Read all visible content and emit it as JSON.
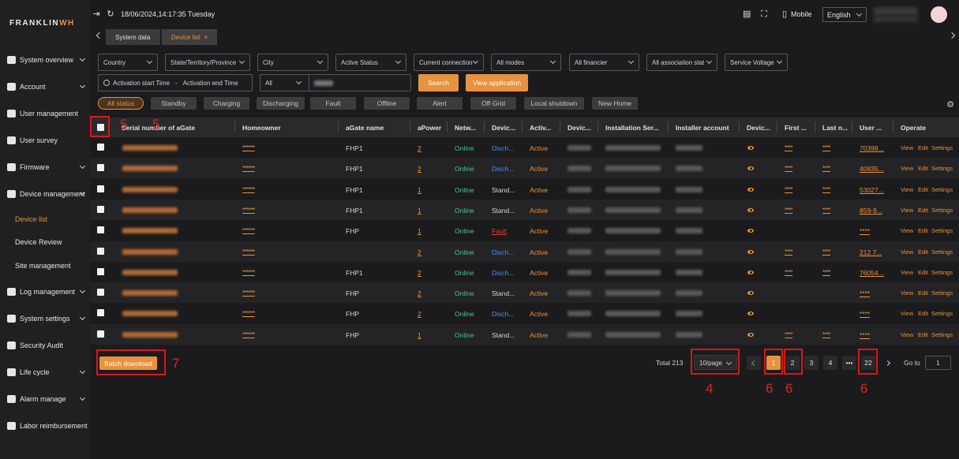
{
  "brand": {
    "logo_pre": "FRANKLIN",
    "logo_post": "WH"
  },
  "header": {
    "datetime": "18/06/2024,14:17:35 Tuesday",
    "mobile_label": "Mobile",
    "language": "English"
  },
  "sidebar": {
    "items": [
      {
        "label": "System overview",
        "has_chevron": true
      },
      {
        "label": "Account",
        "has_chevron": true
      },
      {
        "label": "User management",
        "has_chevron": false
      },
      {
        "label": "User survey",
        "has_chevron": false
      },
      {
        "label": "Firmware",
        "has_chevron": true
      },
      {
        "label": "Device management",
        "has_chevron": true
      },
      {
        "label": "Log management",
        "has_chevron": true
      },
      {
        "label": "System settings",
        "has_chevron": true
      },
      {
        "label": "Security Audit",
        "has_chevron": false
      },
      {
        "label": "Life cycle",
        "has_chevron": true
      },
      {
        "label": "Alarm manage",
        "has_chevron": true
      },
      {
        "label": "Labor reimbursement",
        "has_chevron": false
      }
    ],
    "sub_items": [
      "Device list",
      "Device Review",
      "Site management"
    ],
    "active_sub": "Device list"
  },
  "tabs": {
    "system_data": "System data",
    "device_list": "Device list",
    "close": "×"
  },
  "filters": {
    "row1": [
      "Country",
      "State/Territory/Province",
      "City",
      "Active Status",
      "Current connection",
      "All modes",
      "All financier",
      "All association stat",
      "Service Voltage"
    ],
    "activation_start": "Activation start Time",
    "date_sep": "-",
    "activation_end": "Activation end Time",
    "scope": "All",
    "search_button": "Search",
    "view_application_button": "View application"
  },
  "status_chips": [
    "All status",
    "Standby",
    "Charging",
    "Discharging",
    "Fault",
    "Offline",
    "Alert",
    "Off-Grid",
    "Local shutdown",
    "New Home"
  ],
  "table": {
    "headers": [
      "Serial number of aGate",
      "Homeowner",
      "aGate name",
      "aPower",
      "Netw...",
      "Devic...",
      "Activ...",
      "Devic...",
      "Installation Ser...",
      "Installer account",
      "Devic...",
      "First ...",
      "Last n...",
      "User ...",
      "Operate"
    ],
    "rows": [
      {
        "homeowner": "******",
        "agate_name": "FHP1",
        "apower": "2",
        "network": "Online",
        "device_status": "Disch...",
        "active": "Active",
        "first": "****",
        "last": "****",
        "user": "70398..."
      },
      {
        "homeowner": "******",
        "agate_name": "FHP1",
        "apower": "2",
        "network": "Online",
        "device_status": "Disch...",
        "active": "Active",
        "first": "****",
        "last": "****",
        "user": "40835..."
      },
      {
        "homeowner": "******",
        "agate_name": "FHP1",
        "apower": "1",
        "network": "Online",
        "device_status": "Stand...",
        "active": "Active",
        "first": "****",
        "last": "****",
        "user": "53027..."
      },
      {
        "homeowner": "******",
        "agate_name": "FHP1",
        "apower": "1",
        "network": "Online",
        "device_status": "Stand...",
        "active": "Active",
        "first": "****",
        "last": "****",
        "user": "859-9..."
      },
      {
        "homeowner": "******",
        "agate_name": "FHP",
        "apower": "1",
        "network": "Online",
        "device_status": "Fault",
        "active": "Active",
        "first": "",
        "last": "",
        "user": "****"
      },
      {
        "homeowner": "******",
        "agate_name": "",
        "apower": "2",
        "network": "Online",
        "device_status": "Disch...",
        "active": "Active",
        "first": "****",
        "last": "****",
        "user": "212 7..."
      },
      {
        "homeowner": "******",
        "agate_name": "FHP1",
        "apower": "2",
        "network": "Online",
        "device_status": "Disch...",
        "active": "Active",
        "first": "****",
        "last": "****",
        "user": "76054..."
      },
      {
        "homeowner": "******",
        "agate_name": "FHP",
        "apower": "2",
        "network": "Online",
        "device_status": "Stand...",
        "active": "Active",
        "first": "",
        "last": "",
        "user": "****"
      },
      {
        "homeowner": "******",
        "agate_name": "FHP",
        "apower": "2",
        "network": "Online",
        "device_status": "Disch...",
        "active": "Active",
        "first": "",
        "last": "",
        "user": "****"
      },
      {
        "homeowner": "******",
        "agate_name": "FHP",
        "apower": "1",
        "network": "Online",
        "device_status": "Stand...",
        "active": "Active",
        "first": "****",
        "last": "****",
        "user": "****"
      }
    ],
    "operate": {
      "view": "View",
      "edit": "Edit",
      "settings": "Settings"
    }
  },
  "batch_download": "Batch download",
  "pagination": {
    "total": "Total 213",
    "page_size": "10/page",
    "pages": [
      "1",
      "2",
      "3",
      "4",
      "•••",
      "22"
    ],
    "goto_label": "Go to",
    "goto_value": "1"
  },
  "annotations": {
    "a1": "5",
    "a2": "5",
    "a3": "7",
    "a4": "4",
    "a5": "6",
    "a6": "6",
    "a7": "6"
  },
  "colors": {
    "accent": "#e8913e",
    "online": "#4cc38a",
    "discharging": "#4c8cf0",
    "fault": "#e53935",
    "annotation": "#d8161c"
  }
}
